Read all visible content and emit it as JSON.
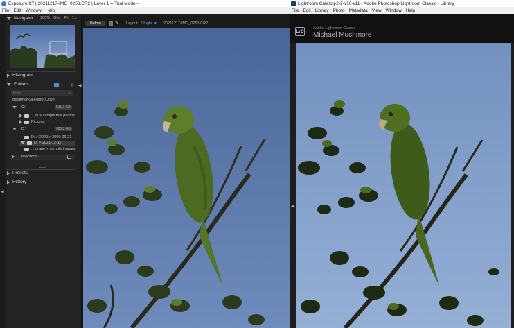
{
  "exposure": {
    "title": "Exposure X7 | 20211217-IMG_0253.CR2 | Layer 1 -- Trial Mode --",
    "menu": [
      "File",
      "Edit",
      "Window",
      "Help"
    ],
    "navigator": {
      "label": "Navigator",
      "zoom": "100%",
      "grid": "Grid",
      "fit": "Fit",
      "one_to_one": "1:1"
    },
    "histogram_label": "Histogram",
    "folders": {
      "label": "Folders",
      "filter_placeholder": "Filter",
      "bookmark": "Bookmark a Folder/Drive",
      "drive_c": "C:\\",
      "drive_c_size": "511.3 GB",
      "c_items": [
        "...es > sample test photos",
        "Pictures"
      ],
      "drive_d": "D:\\",
      "drive_d_size": "985.2 GB",
      "d_items": [
        "D: > 2020 > 2020-06-21",
        "D: > 2021-12-17",
        "...torage > sample images"
      ],
      "collections": "Collections"
    },
    "presets_label": "Presets",
    "history_label": "History",
    "toolbar": {
      "before": "Before",
      "layout_label": "Layout:",
      "layout_value": "Single",
      "filename": "20211217-IMG_0253.CR2"
    }
  },
  "lightroom": {
    "title": "Lightroom Catalog-2-2-v10-v11 - Adobe Photoshop Lightroom Classic - Library",
    "menu": [
      "File",
      "Edit",
      "Library",
      "Photo",
      "Metadata",
      "View",
      "Window",
      "Help"
    ],
    "logo": "LrC",
    "brand": "Adobe Lightroom Classic",
    "user": "Michael Muchmore"
  },
  "colors": {
    "sky_left": "#5a76a3",
    "sky_right": "#7e9cc8",
    "parrot_green": "#5b7a2a",
    "panel_bg": "#232323"
  },
  "icons": {
    "exposure_app": "exposure-app-icon",
    "lightroom_app": "lightroom-app-icon"
  }
}
